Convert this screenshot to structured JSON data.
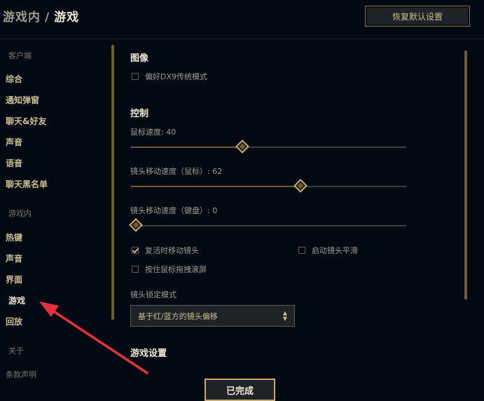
{
  "header": {
    "breadcrumb_parent": "游戏内",
    "separator": "/",
    "breadcrumb_current": "游戏",
    "reset_button": "恢复默认设置"
  },
  "sidebar": {
    "groups": [
      {
        "label": "客户端",
        "items": [
          "综合",
          "通知弹窗",
          "聊天&好友",
          "声音",
          "语音",
          "聊天黑名单"
        ]
      },
      {
        "label": "游戏内",
        "items": [
          "热键",
          "声音",
          "界面",
          "游戏",
          "回放"
        ]
      },
      {
        "label": "关于",
        "items": [
          "条款声明"
        ]
      }
    ],
    "active_item": "游戏"
  },
  "sections": {
    "image": {
      "title": "图像",
      "dx9_label": "偏好DX9传统模式",
      "dx9_checked": false
    },
    "control": {
      "title": "控制",
      "mouse_speed_label": "鼠标速度: 40",
      "mouse_speed_value": 40,
      "camera_mouse_label": "镜头移动速度（鼠标）: 62",
      "camera_mouse_value": 62,
      "camera_keyboard_label": "镜头移动速度（键盘）: 0",
      "camera_keyboard_value": 0,
      "revive_camera_label": "复活时移动镜头",
      "revive_camera_checked": true,
      "smooth_camera_label": "启动镜头平滑",
      "smooth_camera_checked": false,
      "drag_scroll_label": "按住鼠标拖拽滚屏",
      "drag_scroll_checked": false,
      "lock_mode_label": "镜头锁定模式",
      "lock_mode_value": "基于红/蓝方的镜头偏移"
    },
    "game_settings": {
      "title": "游戏设置"
    }
  },
  "footer": {
    "done_button": "已完成"
  },
  "colors": {
    "background": "#010a13",
    "gold": "#c8aa6e",
    "gold_dark": "#785a28",
    "text": "#cdbe91",
    "annotation_arrow": "#e8303a"
  }
}
